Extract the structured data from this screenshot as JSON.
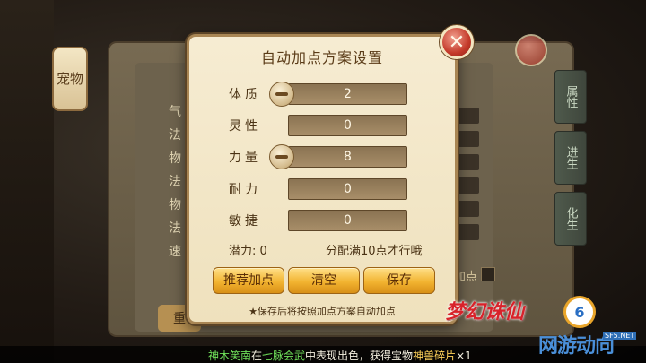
{
  "background": {
    "pet_tab": "宠物",
    "labels": [
      "气",
      "法",
      "物",
      "法",
      "物",
      "法",
      "速"
    ],
    "side_tabs": [
      "属性",
      "进生",
      "化生"
    ],
    "bottom_left_button": "重",
    "checkbox_label": "加点"
  },
  "dialog": {
    "title": "自动加点方案设置",
    "close_label": "✕",
    "stats": [
      {
        "label": "体质",
        "value": "2",
        "has_minus": true
      },
      {
        "label": "灵性",
        "value": "0",
        "has_minus": false
      },
      {
        "label": "力量",
        "value": "8",
        "has_minus": true
      },
      {
        "label": "耐力",
        "value": "0",
        "has_minus": false
      },
      {
        "label": "敏捷",
        "value": "0",
        "has_minus": false
      }
    ],
    "potential": "潜力: 0",
    "hint": "分配满10点才行哦",
    "buttons": {
      "recommend": "推荐加点",
      "clear": "清空",
      "save": "保存"
    },
    "footnote": "★保存后将按照加点方案自动加点"
  },
  "ticker": {
    "name": "神木笑南",
    "mid1": "在",
    "event": "七脉会武",
    "mid2": "中表现出色，获得宝物",
    "item": "神兽碎片",
    "count": "×1"
  },
  "branding": {
    "game_logo": "梦幻诛仙",
    "badge": "6",
    "site_logo": "网游动向",
    "site_tag": "SF5.NET"
  },
  "colors": {
    "accent_gold": "#f2b431",
    "close_red": "#c43a2a",
    "panel_cream": "#f6ecd2"
  }
}
